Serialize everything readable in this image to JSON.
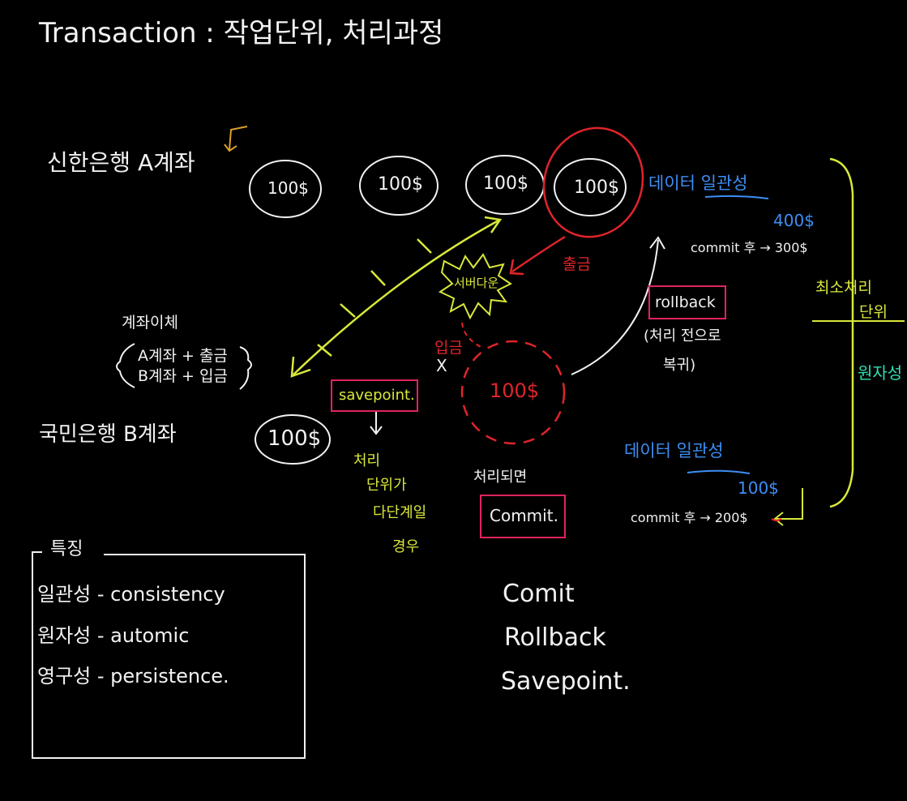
{
  "title": "Transaction : 작업단위, 처리과정",
  "accounts": {
    "a_label": "신한은행 A계좌",
    "b_label": "국민은행 B계좌",
    "coin": "100$",
    "coin_mid": "100$"
  },
  "transfer": {
    "heading": "계좌이체",
    "line1": "A계좌 + 출금",
    "line2": "B계좌 + 입금"
  },
  "labels": {
    "server_down": "서버다운",
    "withdraw": "출금",
    "deposit": "입금",
    "x_mark": "X",
    "savepoint": "savepoint.",
    "savepoint_note": [
      "처리",
      "단위가",
      "다단계일",
      "경우"
    ],
    "on_process": "처리되면",
    "commit": "Commit.",
    "rollback": "rollback",
    "rollback_note": [
      "(처리 전으로",
      "복귀)"
    ]
  },
  "consistency_top": {
    "title": "데이터 일관성",
    "amount": "400$",
    "after": "commit 후 → 300$"
  },
  "consistency_bottom": {
    "title": "데이터 일관성",
    "amount": "100$",
    "after": "commit 후 → 200$"
  },
  "side": {
    "min_unit": [
      "최소처리",
      "단위"
    ],
    "atomicity": "원자성"
  },
  "features": {
    "title": "특징",
    "items": [
      "일관성 - consistency",
      "원자성 - automic",
      "영구성 - persistence."
    ]
  },
  "commands": [
    "Comit",
    "Rollback",
    "Savepoint."
  ],
  "colors": {
    "chalk": "#f2f2f2",
    "blue": "#3d8ef5",
    "yellow": "#d8e83a",
    "red": "#e0242a",
    "pink": "#e0245e",
    "teal": "#2fe0b3"
  }
}
